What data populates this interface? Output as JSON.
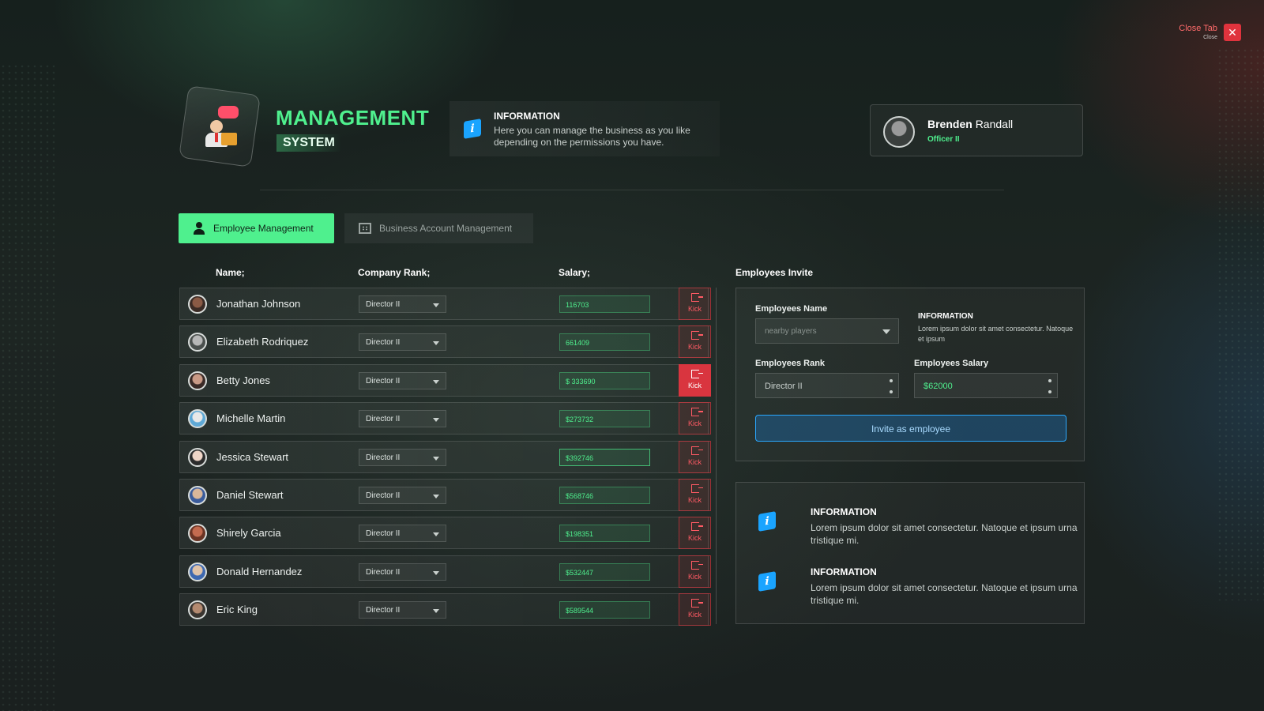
{
  "close": {
    "title": "Close Tab",
    "sub": "Close",
    "icon": "close-icon"
  },
  "header": {
    "title": "MANAGEMENT",
    "subtitle": "SYSTEM",
    "info_title": "INFORMATION",
    "info_text": "Here you can manage the business as you like depending on the permissions you have."
  },
  "profile": {
    "first_name": "Brenden",
    "last_name": "Randall",
    "rank": "Officer II"
  },
  "tabs": [
    {
      "label": "Employee Management",
      "icon": "user-icon",
      "active": true
    },
    {
      "label": "Business Account Management",
      "icon": "building-icon",
      "active": false
    }
  ],
  "table": {
    "headers": {
      "name": "Name;",
      "rank": "Company Rank;",
      "salary": "Salary;"
    },
    "kick_label": "Kick",
    "rows": [
      {
        "name": "Jonathan Johnson",
        "rank": "Director II",
        "salary": "116703"
      },
      {
        "name": "Elizabeth Rodriquez",
        "rank": "Director II",
        "salary": "661409"
      },
      {
        "name": "Betty Jones",
        "rank": "Director II",
        "salary": "$ 333690"
      },
      {
        "name": "Michelle Martin",
        "rank": "Director II",
        "salary": "$273732"
      },
      {
        "name": "Jessica Stewart",
        "rank": "Director II",
        "salary": "$392746"
      },
      {
        "name": "Daniel Stewart",
        "rank": "Director II",
        "salary": "$568746"
      },
      {
        "name": "Shirely Garcia",
        "rank": "Director II",
        "salary": "$198351"
      },
      {
        "name": "Donald Hernandez",
        "rank": "Director II",
        "salary": "$532447"
      },
      {
        "name": "Eric King",
        "rank": "Director II",
        "salary": "$589544"
      }
    ]
  },
  "invite": {
    "title": "Employees Invite",
    "name_label": "Employees Name",
    "name_placeholder": "nearby players",
    "rank_label": "Employees Rank",
    "rank_value": "Director II",
    "salary_label": "Employees Salary",
    "salary_value": "$62000",
    "info_title": "INFORMATION",
    "info_text": "Lorem ipsum dolor sit amet consectetur. Natoque et ipsum",
    "button": "Invite as employee"
  },
  "info_panel": [
    {
      "title": "INFORMATION",
      "text": "Lorem ipsum dolor sit amet consectetur. Natoque et ipsum urna tristique mi."
    },
    {
      "title": "INFORMATION",
      "text": "Lorem ipsum dolor sit amet consectetur. Natoque et ipsum urna tristique mi."
    }
  ],
  "colors": {
    "accent": "#4ff08e",
    "danger": "#e0333d",
    "info": "#1aa4ff"
  }
}
